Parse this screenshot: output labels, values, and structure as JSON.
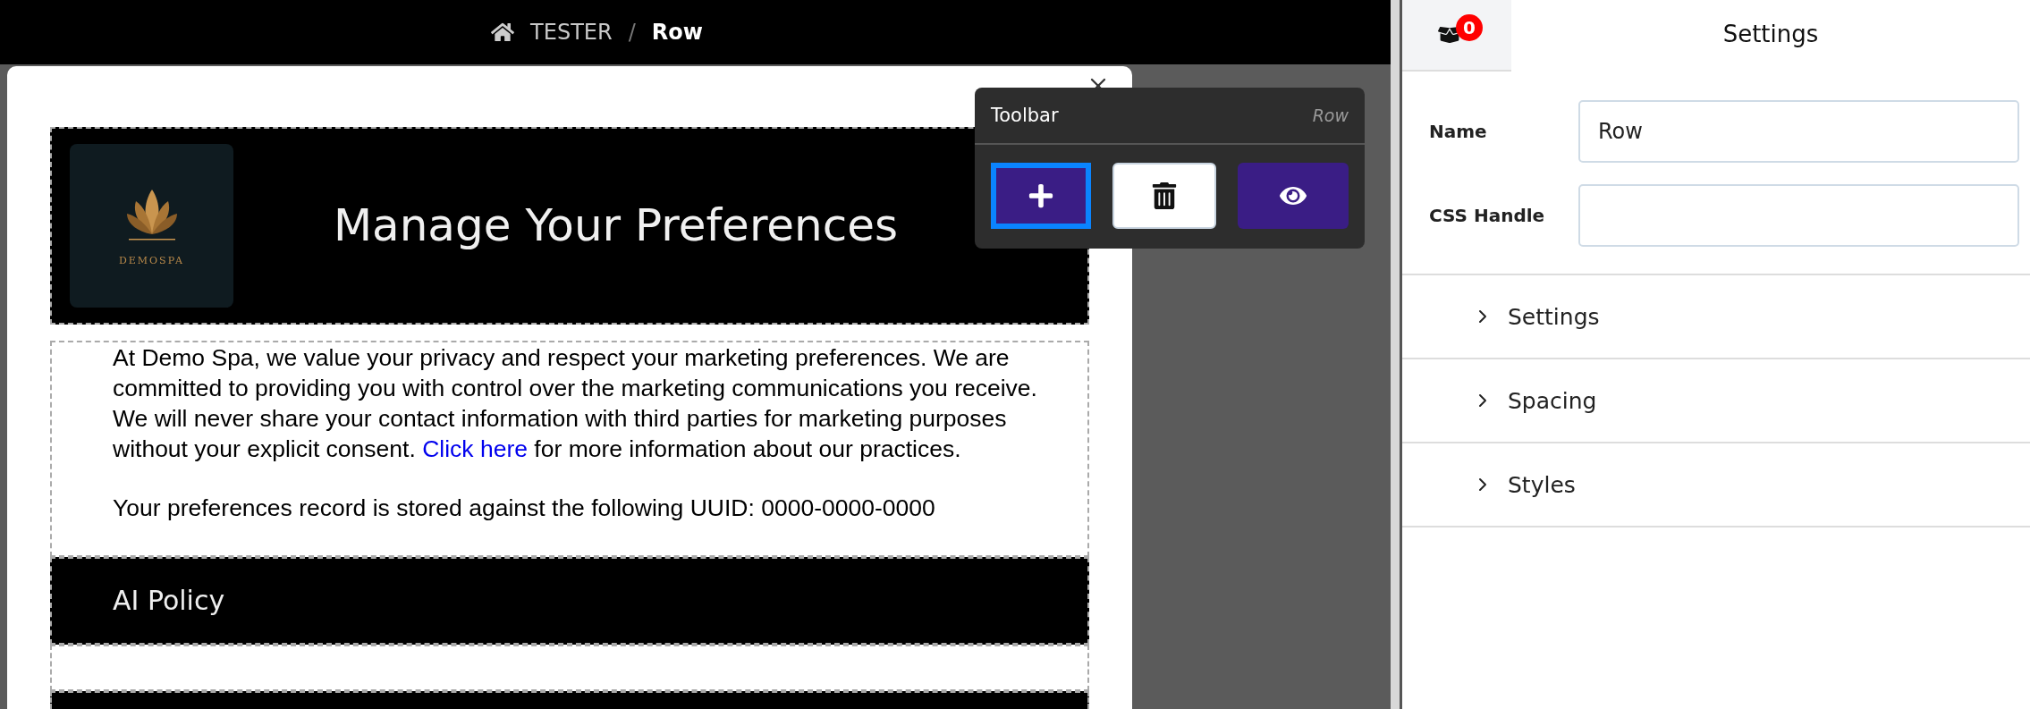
{
  "breadcrumb": {
    "items": [
      {
        "label": "TESTER",
        "current": false
      },
      {
        "label": "Row",
        "current": true
      }
    ],
    "separator": "/"
  },
  "email": {
    "logo_text": "DEMOSPA",
    "title": "Manage Your Preferences",
    "intro": {
      "before": "At Demo Spa, we value your privacy and respect your marketing preferences. We are committed to providing you with control over the marketing communications you receive. We will never share your contact information with third parties for marketing purposes without your explicit consent. ",
      "link": "Click here",
      "after": " for more information about our practices."
    },
    "uuid_line": "Your preferences record is stored against the following UUID: 0000-0000-0000",
    "section_title": "AI Policy"
  },
  "toolbar": {
    "title": "Toolbar",
    "context": "Row",
    "buttons": [
      {
        "kind": "add",
        "focused": true
      },
      {
        "kind": "delete",
        "focused": false
      },
      {
        "kind": "preview",
        "focused": false
      }
    ]
  },
  "panel": {
    "badge": "0",
    "title": "Settings",
    "fields": [
      {
        "label": "Name",
        "value": "Row"
      },
      {
        "label": "CSS Handle"
      }
    ],
    "sections": [
      {
        "label": "Settings",
        "expanded": false
      },
      {
        "label": "Spacing",
        "expanded": false
      },
      {
        "label": "Styles",
        "expanded": false
      }
    ]
  }
}
